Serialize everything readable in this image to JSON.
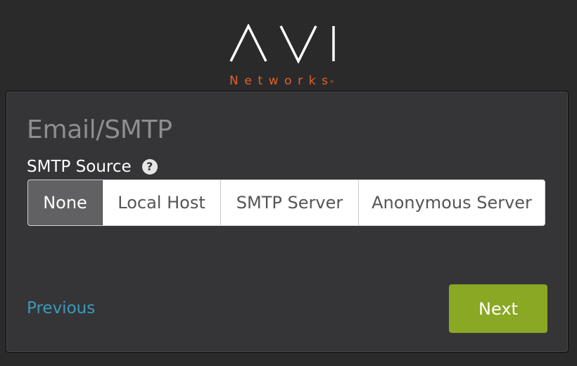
{
  "brand": {
    "logo_text": "AVI",
    "logo_subtext": "Networks",
    "logo_mark": "®",
    "accent_color": "#e0622b"
  },
  "panel": {
    "title": "Email/SMTP",
    "smtp_source": {
      "label": "SMTP Source",
      "help_icon": "question-circle-icon",
      "help_glyph": "?",
      "options": [
        {
          "label": "None",
          "selected": true
        },
        {
          "label": "Local Host",
          "selected": false
        },
        {
          "label": "SMTP Server",
          "selected": false
        },
        {
          "label": "Anonymous Server",
          "selected": false
        }
      ]
    },
    "previous_label": "Previous",
    "next_label": "Next"
  },
  "colors": {
    "link": "#3b9ab6",
    "primary_button": "#89a823",
    "selected_segment": "#616163"
  }
}
